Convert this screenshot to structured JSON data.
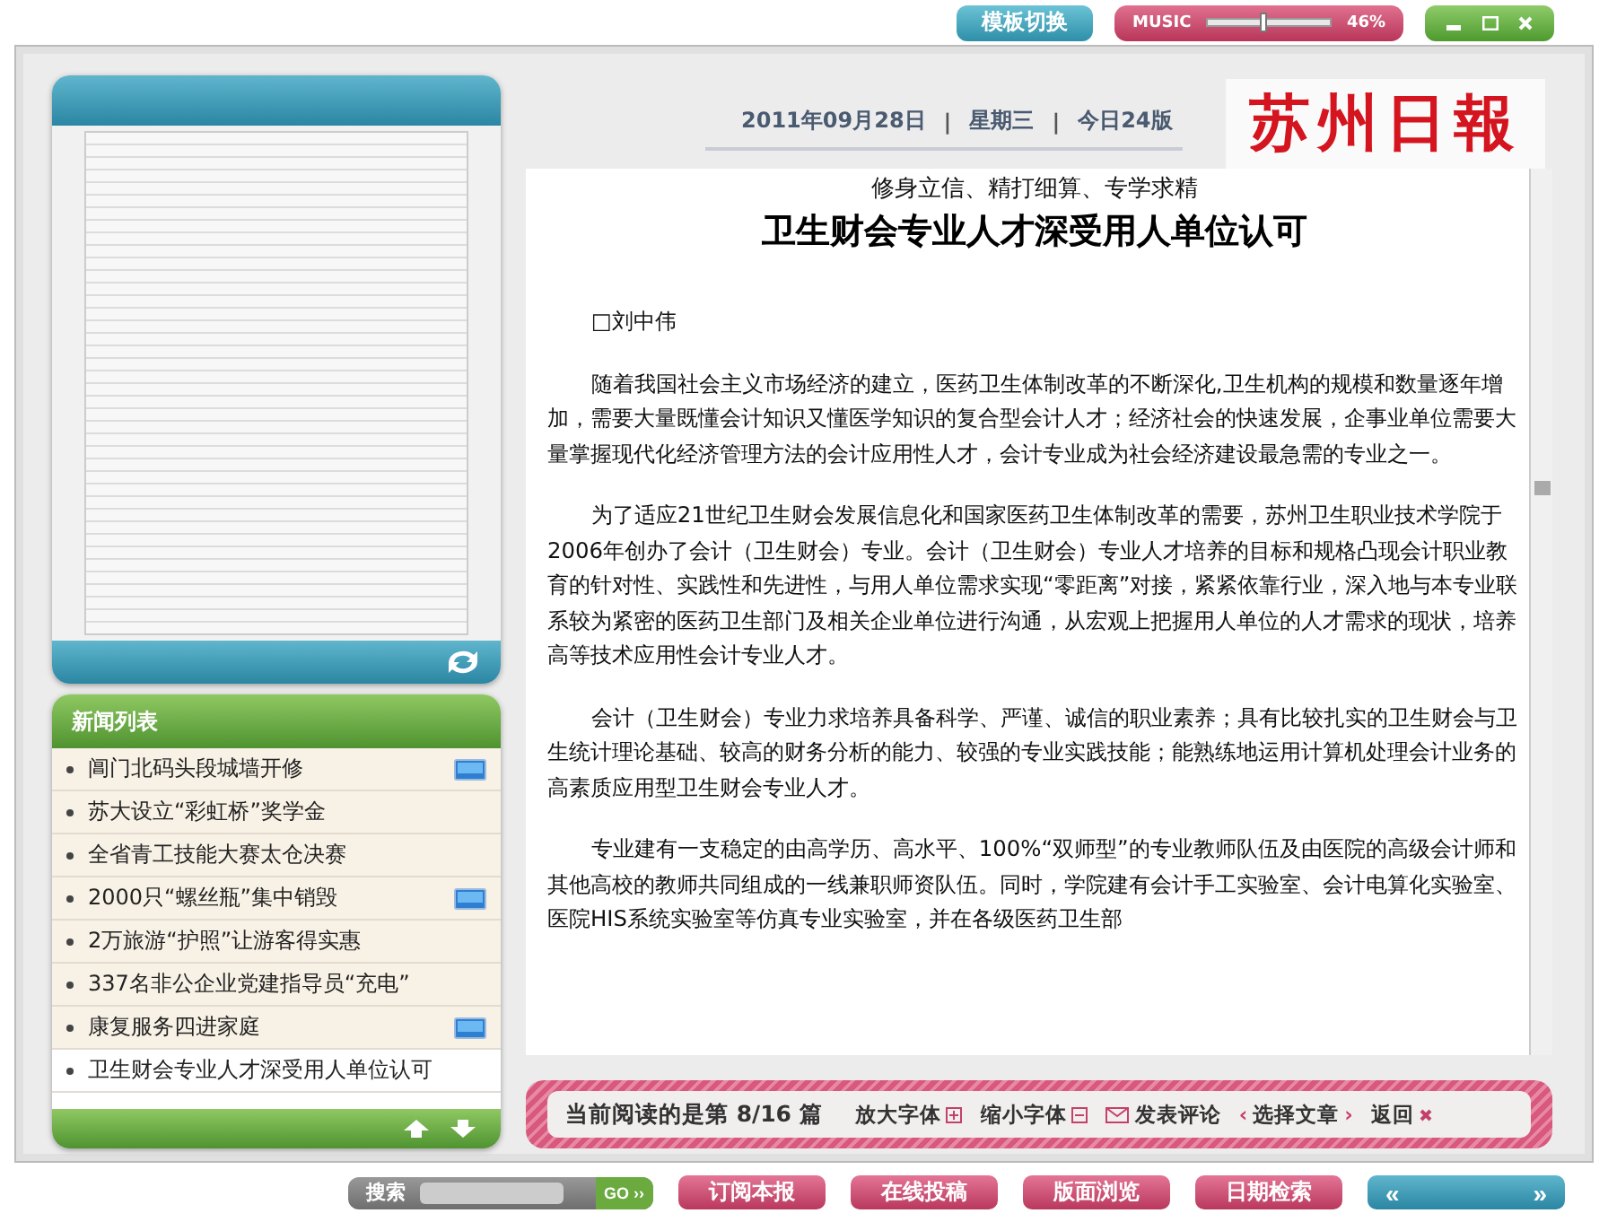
{
  "top_bar": {
    "template_button": "模板切换",
    "music": {
      "label": "MUSIC",
      "level": 0.46,
      "reading": "46%"
    }
  },
  "header": {
    "date": "2011年09月28日",
    "separators": [
      "|",
      "|"
    ],
    "weekday": "星期三",
    "edition": "今日24版",
    "logo": "苏州日報"
  },
  "news_list": {
    "title": "新闻列表",
    "items": [
      {
        "label": "阊门北码头段城墙开修",
        "video": true,
        "selected": false
      },
      {
        "label": "苏大设立“彩虹桥”奖学金",
        "video": false,
        "selected": false
      },
      {
        "label": "全省青工技能大赛太仓决赛",
        "video": false,
        "selected": false
      },
      {
        "label": "2000只“螺丝瓶”集中销毁",
        "video": true,
        "selected": false
      },
      {
        "label": "2万旅游“护照”让游客得实惠",
        "video": false,
        "selected": false
      },
      {
        "label": "337名非公企业党建指导员“充电”",
        "video": false,
        "selected": false
      },
      {
        "label": "康复服务四进家庭",
        "video": true,
        "selected": false
      },
      {
        "label": "卫生财会专业人才深受用人单位认可",
        "video": false,
        "selected": true
      }
    ]
  },
  "article": {
    "subtitle": "修身立信、精打细算、专学求精",
    "title": "卫生财会专业人才深受用人单位认可",
    "author": "□刘中伟",
    "paragraphs": [
      "随着我国社会主义市场经济的建立，医药卫生体制改革的不断深化,卫生机构的规模和数量逐年增加，需要大量既懂会计知识又懂医学知识的复合型会计人才；经济社会的快速发展，企事业单位需要大量掌握现代化经济管理方法的会计应用性人才，会计专业成为社会经济建设最急需的专业之一。",
      "为了适应21世纪卫生财会发展信息化和国家医药卫生体制改革的需要，苏州卫生职业技术学院于2006年创办了会计（卫生财会）专业。会计（卫生财会）专业人才培养的目标和规格凸现会计职业教育的针对性、实践性和先进性，与用人单位需求实现“零距离”对接，紧紧依靠行业，深入地与本专业联系较为紧密的医药卫生部门及相关企业单位进行沟通，从宏观上把握用人单位的人才需求的现状，培养高等技术应用性会计专业人才。",
      "会计（卫生财会）专业力求培养具备科学、严谨、诚信的职业素养；具有比较扎实的卫生财会与卫生统计理论基础、较高的财务分析的能力、较强的专业实践技能；能熟练地运用计算机处理会计业务的高素质应用型卫生财会专业人才。",
      "专业建有一支稳定的由高学历、高水平、100%“双师型”的专业教师队伍及由医院的高级会计师和其他高校的教师共同组成的一线兼职师资队伍。同时，学院建有会计手工实验室、会计电算化实验室、医院HIS系统实验室等仿真专业实验室，并在各级医药卫生部"
    ]
  },
  "reading_bar": {
    "position": "当前阅读的是第 8/16 篇",
    "actions": [
      {
        "kind": "enlarge",
        "label": "放大字体"
      },
      {
        "kind": "shrink",
        "label": "缩小字体"
      },
      {
        "kind": "comment",
        "label": "发表评论"
      },
      {
        "kind": "select",
        "label": "选择文章",
        "prev": "‹",
        "next": "›"
      },
      {
        "kind": "back",
        "label": "返回"
      }
    ]
  },
  "bottom_bar": {
    "search_label": "搜索",
    "go": "GO ››",
    "buttons": [
      "订阅本报",
      "在线投稿",
      "版面浏览",
      "日期检索"
    ],
    "prev": "«",
    "next": "»"
  }
}
